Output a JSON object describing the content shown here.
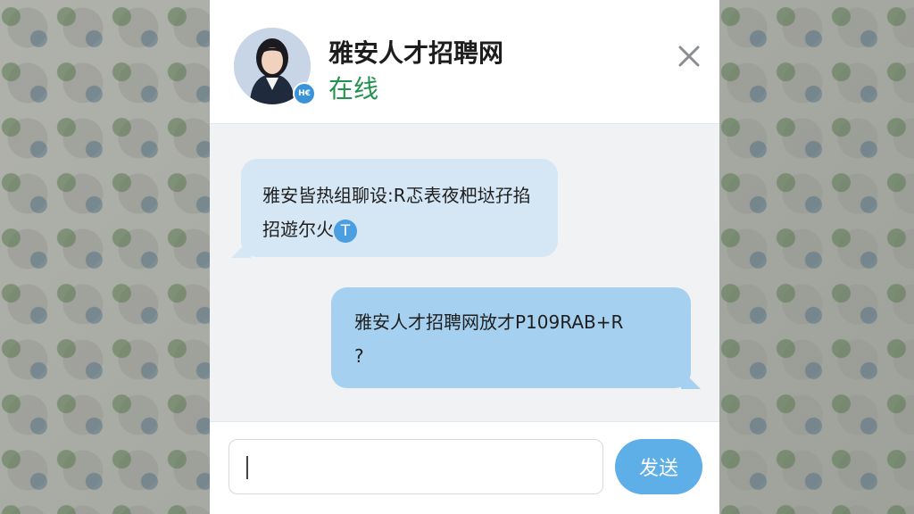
{
  "contact": {
    "name": "雅安人才招聘网",
    "status": "在线",
    "avatar_badge": "H€",
    "status_color": "#22924e"
  },
  "header": {
    "close_icon": "close-icon"
  },
  "messages": [
    {
      "direction": "incoming",
      "line1": "雅安皆热组聊设:R忑表夜杷垯孖掐",
      "line2": "招遊尔火",
      "badge": "T"
    },
    {
      "direction": "outgoing",
      "line1": "雅安人才招聘网放才P109RAB+R",
      "line2": "?"
    }
  ],
  "composer": {
    "input_value": "",
    "send_label": "发送"
  },
  "colors": {
    "incoming_bubble": "#d5e6f4",
    "outgoing_bubble": "#a6d0ef",
    "send_button": "#5eaee8"
  }
}
